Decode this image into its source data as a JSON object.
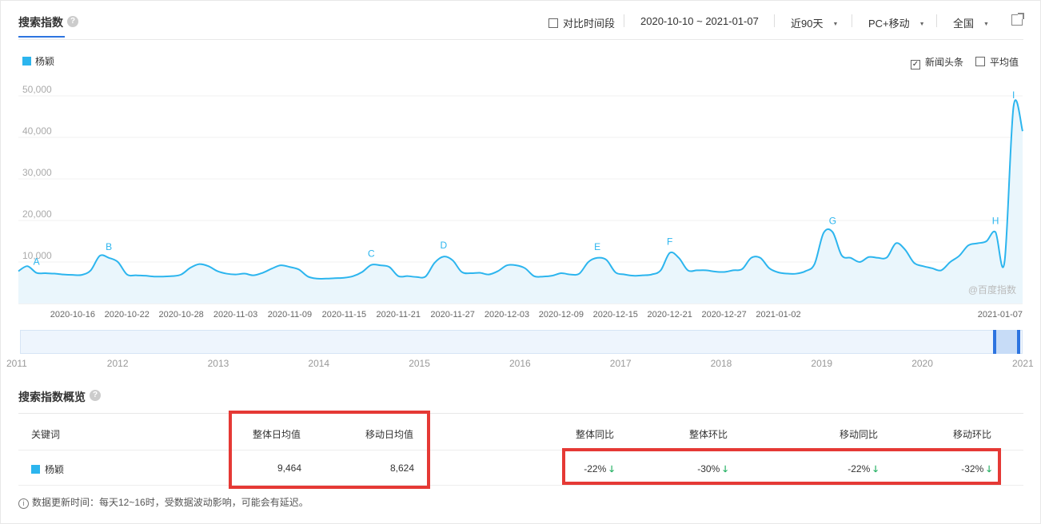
{
  "header": {
    "title": "搜索指数",
    "help": "?",
    "compare_label": "对比时间段",
    "date_range": "2020-10-10 ~ 2021-01-07",
    "period": "近90天",
    "device": "PC+移动",
    "region": "全国"
  },
  "legend": {
    "series_name": "杨颖",
    "color": "#2cb5ee"
  },
  "options": {
    "news_label": "新闻头条",
    "news_checked": true,
    "avg_label": "平均值",
    "avg_checked": false
  },
  "watermark": "@百度指数",
  "chart_data": {
    "type": "area",
    "series": [
      {
        "name": "杨颖",
        "color": "#2cb5ee",
        "values": [
          7800,
          9000,
          7400,
          7300,
          7200,
          7000,
          6900,
          6900,
          8000,
          11500,
          11000,
          10000,
          7000,
          6800,
          6700,
          6500,
          6500,
          6600,
          7000,
          8600,
          9500,
          9000,
          7800,
          7200,
          7000,
          7200,
          6800,
          7400,
          8400,
          9200,
          8800,
          8200,
          6500,
          6000,
          6000,
          6100,
          6200,
          6600,
          7600,
          9300,
          9200,
          8800,
          6600,
          6600,
          6400,
          6500,
          9800,
          11300,
          10400,
          7600,
          7300,
          7400,
          7000,
          7800,
          9200,
          9200,
          8500,
          6600,
          6500,
          6700,
          7300,
          7000,
          7200,
          10000,
          11000,
          10500,
          7500,
          7000,
          6700,
          6800,
          7000,
          8000,
          12200,
          11000,
          8000,
          8000,
          8000,
          7700,
          7600,
          8000,
          8300,
          11000,
          11000,
          8500,
          7500,
          7200,
          7200,
          7800,
          9500,
          17000,
          17200,
          11600,
          11000,
          10000,
          11200,
          11000,
          11100,
          14500,
          13000,
          9800,
          9000,
          8500,
          8000,
          10000,
          11500,
          14000,
          14500,
          15000,
          17200,
          10000,
          47500,
          41500
        ]
      }
    ],
    "ylim": [
      0,
      50000
    ],
    "yticks": [
      "10,000",
      "20,000",
      "30,000",
      "40,000",
      "50,000"
    ],
    "xticks": [
      "2020-10-16",
      "2020-10-22",
      "2020-10-28",
      "2020-11-03",
      "2020-11-09",
      "2020-11-15",
      "2020-11-21",
      "2020-11-27",
      "2020-12-03",
      "2020-12-09",
      "2020-12-15",
      "2020-12-21",
      "2020-12-27",
      "2021-01-02",
      "2021-01-07"
    ],
    "peak_labels": [
      {
        "label": "A",
        "index": 2
      },
      {
        "label": "B",
        "index": 10
      },
      {
        "label": "C",
        "index": 39
      },
      {
        "label": "D",
        "index": 47
      },
      {
        "label": "E",
        "index": 64
      },
      {
        "label": "F",
        "index": 72
      },
      {
        "label": "G",
        "index": 90
      },
      {
        "label": "H",
        "index": 108
      },
      {
        "label": "I",
        "index": 110
      }
    ],
    "grid": true
  },
  "slider": {
    "years": [
      "2011",
      "2012",
      "2013",
      "2014",
      "2015",
      "2016",
      "2017",
      "2018",
      "2019",
      "2020",
      "2021"
    ]
  },
  "overview": {
    "title": "搜索指数概览",
    "headers": {
      "keyword": "关键词",
      "overall_avg": "整体日均值",
      "mobile_avg": "移动日均值",
      "overall_yoy": "整体同比",
      "overall_mom": "整体环比",
      "mobile_yoy": "移动同比",
      "mobile_mom": "移动环比"
    },
    "row": {
      "keyword": "杨颖",
      "overall_avg": "9,464",
      "mobile_avg": "8,624",
      "overall_yoy": "-22%",
      "overall_mom": "-30%",
      "mobile_yoy": "-22%",
      "mobile_mom": "-32%",
      "arrow": "🡓"
    },
    "note": "数据更新时间：每天12~16时，受数据波动影响，可能会有延迟。",
    "info_icon": "i"
  }
}
